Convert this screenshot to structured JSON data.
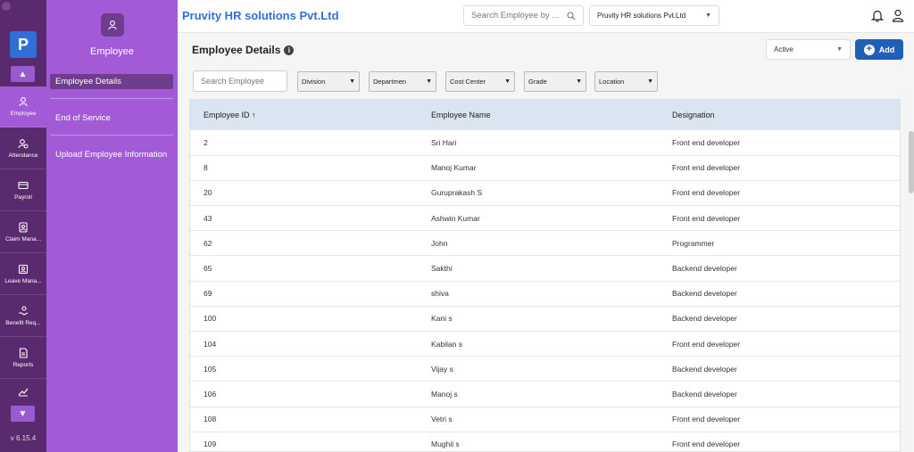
{
  "rail": {
    "logo": "P",
    "items": [
      {
        "label": "Employee",
        "icon": "person-icon"
      },
      {
        "label": "Attendance",
        "icon": "attendance-icon"
      },
      {
        "label": "Payroll",
        "icon": "card-icon"
      },
      {
        "label": "Claim Mana...",
        "icon": "claim-icon"
      },
      {
        "label": "Leave Mana...",
        "icon": "leave-icon"
      },
      {
        "label": "Benefit Req...",
        "icon": "benefit-icon"
      },
      {
        "label": "Reports",
        "icon": "report-icon"
      }
    ],
    "version": "v 6.15.4"
  },
  "sidebar": {
    "title": "Employee",
    "links": [
      "Employee Details",
      "End of Service",
      "Upload Employee Information"
    ]
  },
  "topbar": {
    "brand": "Pruvity HR solutions Pvt.Ltd",
    "search_placeholder": "Search Employee by ...",
    "company": "Pruvity HR solutions Pvt.Ltd"
  },
  "main": {
    "title": "Employee Details",
    "status": "Active",
    "add_label": "Add",
    "search_placeholder": "Search Employee",
    "filters": [
      "Division",
      "Departmen",
      "Cost Center",
      "Grade",
      "Location"
    ]
  },
  "table": {
    "headers": [
      "Employee ID",
      "Employee Name",
      "Designation"
    ],
    "sort_indicator": "↑",
    "rows": [
      [
        "2",
        "Sri Hari",
        "Front end developer"
      ],
      [
        "8",
        "Manoj Kumar",
        "Front end developer"
      ],
      [
        "20",
        "Guruprakash S",
        "Front end developer"
      ],
      [
        "43",
        "Ashwin Kumar",
        "Front end developer"
      ],
      [
        "62",
        "John",
        "Programmer"
      ],
      [
        "65",
        "Sakthi",
        "Backend developer"
      ],
      [
        "69",
        "shiva",
        "Backend developer"
      ],
      [
        "100",
        "Kani s",
        "Backend developer"
      ],
      [
        "104",
        "Kabilan s",
        "Front end developer"
      ],
      [
        "105",
        "Vijay s",
        "Backend developer"
      ],
      [
        "106",
        "Manoj s",
        "Backend developer"
      ],
      [
        "108",
        "Vetri s",
        "Front end developer"
      ],
      [
        "109",
        "Mughil s",
        "Front end developer"
      ]
    ]
  },
  "colors": {
    "rail": "#5a2a6e",
    "sidebar": "#a35ad6",
    "brand": "#2f6fd6",
    "add_button": "#1f5fb8",
    "table_header": "#dbe4f1"
  }
}
